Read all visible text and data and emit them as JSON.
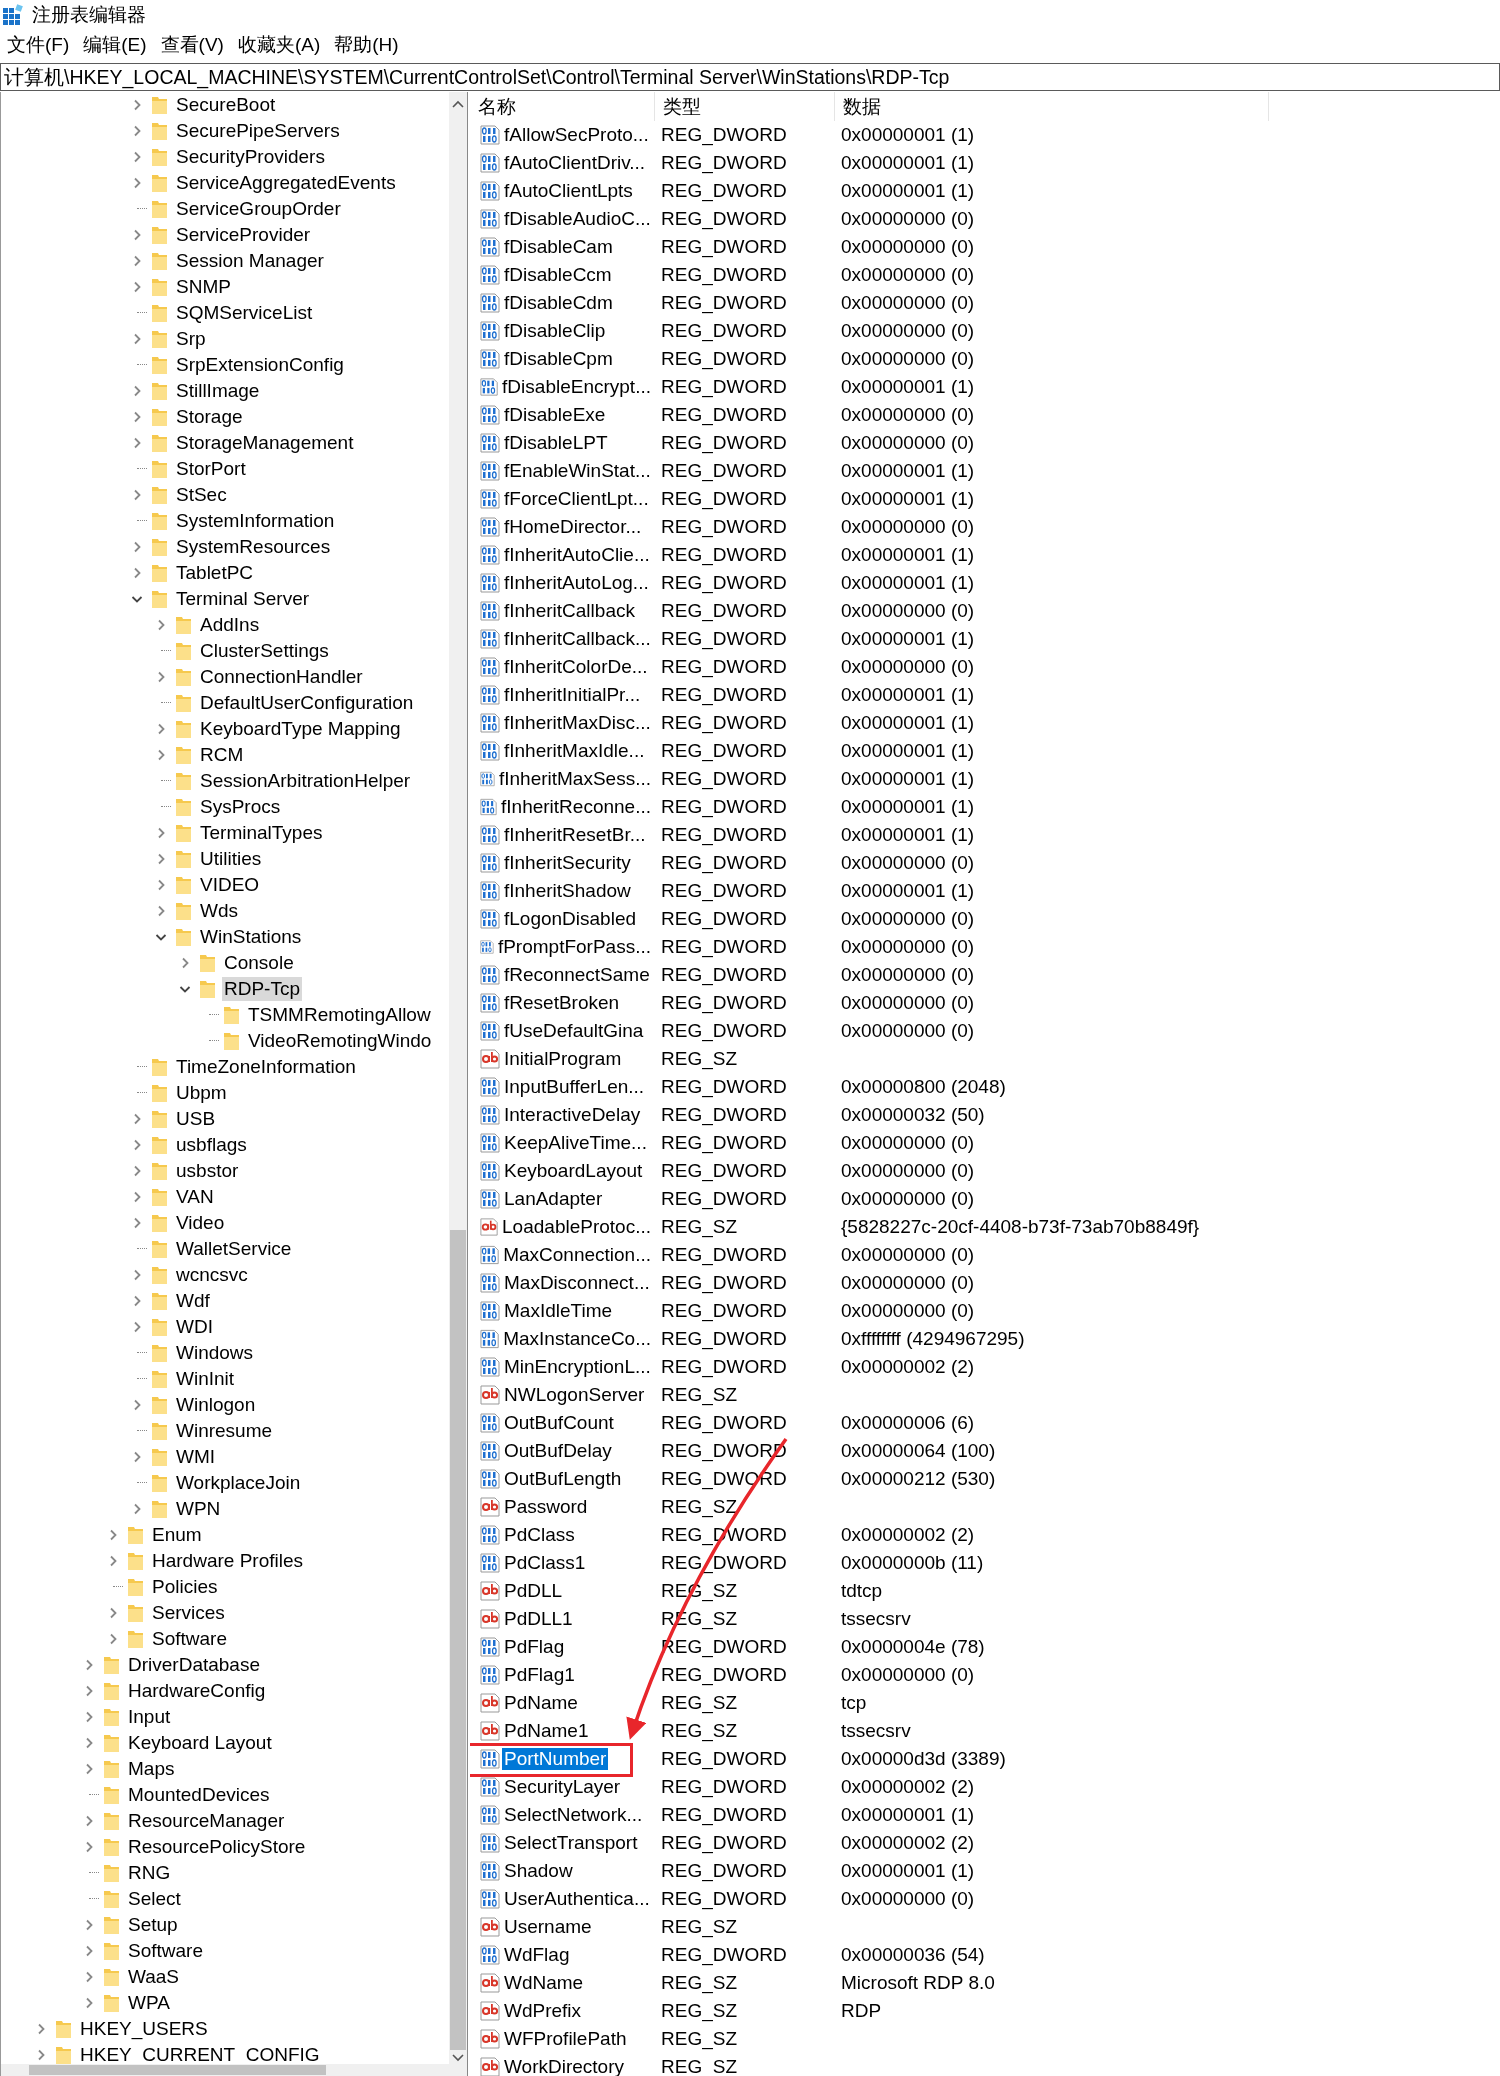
{
  "window": {
    "title": "注册表编辑器"
  },
  "menu": [
    "文件(F)",
    "编辑(E)",
    "查看(V)",
    "收藏夹(A)",
    "帮助(H)"
  ],
  "address": "计算机\\HKEY_LOCAL_MACHINE\\SYSTEM\\CurrentControlSet\\Control\\Terminal Server\\WinStations\\RDP-Tcp",
  "tree": [
    {
      "children": [
        {
          "children": [
            {
              "children": [
                {
                  "children": [
                    {
                      "children": [
                        {
                          "label": "SecureBoot",
                          "expandable": true,
                          "expanded": false,
                          "selected": false
                        },
                        {
                          "label": "SecurePipeServers",
                          "expandable": true,
                          "expanded": false,
                          "selected": false
                        },
                        {
                          "label": "SecurityProviders",
                          "expandable": true,
                          "expanded": false,
                          "selected": false
                        },
                        {
                          "label": "ServiceAggregatedEvents",
                          "expandable": true,
                          "expanded": false,
                          "selected": false
                        },
                        {
                          "label": "ServiceGroupOrder",
                          "expandable": false,
                          "selected": false
                        },
                        {
                          "label": "ServiceProvider",
                          "expandable": true,
                          "expanded": false,
                          "selected": false
                        },
                        {
                          "label": "Session Manager",
                          "expandable": true,
                          "expanded": false,
                          "selected": false
                        },
                        {
                          "label": "SNMP",
                          "expandable": true,
                          "expanded": false,
                          "selected": false
                        },
                        {
                          "label": "SQMServiceList",
                          "expandable": false,
                          "selected": false
                        },
                        {
                          "label": "Srp",
                          "expandable": true,
                          "expanded": false,
                          "selected": false
                        },
                        {
                          "label": "SrpExtensionConfig",
                          "expandable": false,
                          "selected": false
                        },
                        {
                          "label": "StillImage",
                          "expandable": true,
                          "expanded": false,
                          "selected": false
                        },
                        {
                          "label": "Storage",
                          "expandable": true,
                          "expanded": false,
                          "selected": false
                        },
                        {
                          "label": "StorageManagement",
                          "expandable": true,
                          "expanded": false,
                          "selected": false
                        },
                        {
                          "label": "StorPort",
                          "expandable": false,
                          "selected": false
                        },
                        {
                          "label": "StSec",
                          "expandable": true,
                          "expanded": false,
                          "selected": false
                        },
                        {
                          "label": "SystemInformation",
                          "expandable": false,
                          "selected": false
                        },
                        {
                          "label": "SystemResources",
                          "expandable": true,
                          "expanded": false,
                          "selected": false
                        },
                        {
                          "label": "TabletPC",
                          "expandable": true,
                          "expanded": false,
                          "selected": false
                        },
                        {
                          "label": "Terminal Server",
                          "expandable": true,
                          "expanded": true,
                          "selected": false,
                          "children": [
                            {
                              "label": "AddIns",
                              "expandable": true,
                              "expanded": false,
                              "selected": false
                            },
                            {
                              "label": "ClusterSettings",
                              "expandable": false,
                              "selected": false
                            },
                            {
                              "label": "ConnectionHandler",
                              "expandable": true,
                              "expanded": false,
                              "selected": false
                            },
                            {
                              "label": "DefaultUserConfiguration",
                              "expandable": false,
                              "selected": false
                            },
                            {
                              "label": "KeyboardType Mapping",
                              "expandable": true,
                              "expanded": false,
                              "selected": false
                            },
                            {
                              "label": "RCM",
                              "expandable": true,
                              "expanded": false,
                              "selected": false
                            },
                            {
                              "label": "SessionArbitrationHelper",
                              "expandable": false,
                              "selected": false
                            },
                            {
                              "label": "SysProcs",
                              "expandable": false,
                              "selected": false
                            },
                            {
                              "label": "TerminalTypes",
                              "expandable": true,
                              "expanded": false,
                              "selected": false
                            },
                            {
                              "label": "Utilities",
                              "expandable": true,
                              "expanded": false,
                              "selected": false
                            },
                            {
                              "label": "VIDEO",
                              "expandable": true,
                              "expanded": false,
                              "selected": false
                            },
                            {
                              "label": "Wds",
                              "expandable": true,
                              "expanded": false,
                              "selected": false
                            },
                            {
                              "label": "WinStations",
                              "expandable": true,
                              "expanded": true,
                              "selected": false,
                              "children": [
                                {
                                  "label": "Console",
                                  "expandable": true,
                                  "expanded": false,
                                  "selected": false
                                },
                                {
                                  "label": "RDP-Tcp",
                                  "expandable": true,
                                  "expanded": true,
                                  "selected": true,
                                  "children": [
                                    {
                                      "label": "TSMMRemotingAllow",
                                      "expandable": false,
                                      "selected": false
                                    },
                                    {
                                      "label": "VideoRemotingWindo",
                                      "expandable": false,
                                      "selected": false
                                    }
                                  ]
                                }
                              ]
                            }
                          ]
                        },
                        {
                          "label": "TimeZoneInformation",
                          "expandable": false,
                          "selected": false
                        },
                        {
                          "label": "Ubpm",
                          "expandable": false,
                          "selected": false
                        },
                        {
                          "label": "USB",
                          "expandable": true,
                          "expanded": false,
                          "selected": false
                        },
                        {
                          "label": "usbflags",
                          "expandable": true,
                          "expanded": false,
                          "selected": false
                        },
                        {
                          "label": "usbstor",
                          "expandable": true,
                          "expanded": false,
                          "selected": false
                        },
                        {
                          "label": "VAN",
                          "expandable": true,
                          "expanded": false,
                          "selected": false
                        },
                        {
                          "label": "Video",
                          "expandable": true,
                          "expanded": false,
                          "selected": false
                        },
                        {
                          "label": "WalletService",
                          "expandable": false,
                          "selected": false
                        },
                        {
                          "label": "wcncsvc",
                          "expandable": true,
                          "expanded": false,
                          "selected": false
                        },
                        {
                          "label": "Wdf",
                          "expandable": true,
                          "expanded": false,
                          "selected": false
                        },
                        {
                          "label": "WDI",
                          "expandable": true,
                          "expanded": false,
                          "selected": false
                        },
                        {
                          "label": "Windows",
                          "expandable": false,
                          "selected": false
                        },
                        {
                          "label": "WinInit",
                          "expandable": false,
                          "selected": false
                        },
                        {
                          "label": "Winlogon",
                          "expandable": true,
                          "expanded": false,
                          "selected": false
                        },
                        {
                          "label": "Winresume",
                          "expandable": false,
                          "selected": false
                        },
                        {
                          "label": "WMI",
                          "expandable": true,
                          "expanded": false,
                          "selected": false
                        },
                        {
                          "label": "WorkplaceJoin",
                          "expandable": false,
                          "selected": false
                        },
                        {
                          "label": "WPN",
                          "expandable": true,
                          "expanded": false,
                          "selected": false
                        }
                      ]
                    },
                    {
                      "label": "Enum",
                      "expandable": true,
                      "expanded": false,
                      "selected": false
                    },
                    {
                      "label": "Hardware Profiles",
                      "expandable": true,
                      "expanded": false,
                      "selected": false
                    },
                    {
                      "label": "Policies",
                      "expandable": false,
                      "selected": false
                    },
                    {
                      "label": "Services",
                      "expandable": true,
                      "expanded": false,
                      "selected": false
                    },
                    {
                      "label": "Software",
                      "expandable": true,
                      "expanded": false,
                      "selected": false
                    }
                  ]
                },
                {
                  "label": "DriverDatabase",
                  "expandable": true,
                  "expanded": false,
                  "selected": false
                },
                {
                  "label": "HardwareConfig",
                  "expandable": true,
                  "expanded": false,
                  "selected": false
                },
                {
                  "label": "Input",
                  "expandable": true,
                  "expanded": false,
                  "selected": false
                },
                {
                  "label": "Keyboard Layout",
                  "expandable": true,
                  "expanded": false,
                  "selected": false
                },
                {
                  "label": "Maps",
                  "expandable": true,
                  "expanded": false,
                  "selected": false
                },
                {
                  "label": "MountedDevices",
                  "expandable": false,
                  "selected": false
                },
                {
                  "label": "ResourceManager",
                  "expandable": true,
                  "expanded": false,
                  "selected": false
                },
                {
                  "label": "ResourcePolicyStore",
                  "expandable": true,
                  "expanded": false,
                  "selected": false
                },
                {
                  "label": "RNG",
                  "expandable": false,
                  "selected": false
                },
                {
                  "label": "Select",
                  "expandable": false,
                  "selected": false
                },
                {
                  "label": "Setup",
                  "expandable": true,
                  "expanded": false,
                  "selected": false
                },
                {
                  "label": "Software",
                  "expandable": true,
                  "expanded": false,
                  "selected": false
                },
                {
                  "label": "WaaS",
                  "expandable": true,
                  "expanded": false,
                  "selected": false
                },
                {
                  "label": "WPA",
                  "expandable": true,
                  "expanded": false,
                  "selected": false
                }
              ]
            }
          ]
        },
        {
          "label": "HKEY_USERS",
          "expandable": true,
          "expanded": false,
          "selected": false
        },
        {
          "label": "HKEY_CURRENT_CONFIG",
          "expandable": true,
          "expanded": false,
          "selected": false
        }
      ]
    }
  ],
  "columns": [
    "名称",
    "类型",
    "数据"
  ],
  "values": [
    {
      "name": "fAllowSecProto...",
      "kind": "dword",
      "type": "REG_DWORD",
      "data": "0x00000001 (1)",
      "selected": false
    },
    {
      "name": "fAutoClientDriv...",
      "kind": "dword",
      "type": "REG_DWORD",
      "data": "0x00000001 (1)",
      "selected": false
    },
    {
      "name": "fAutoClientLpts",
      "kind": "dword",
      "type": "REG_DWORD",
      "data": "0x00000001 (1)",
      "selected": false
    },
    {
      "name": "fDisableAudioC...",
      "kind": "dword",
      "type": "REG_DWORD",
      "data": "0x00000000 (0)",
      "selected": false
    },
    {
      "name": "fDisableCam",
      "kind": "dword",
      "type": "REG_DWORD",
      "data": "0x00000000 (0)",
      "selected": false
    },
    {
      "name": "fDisableCcm",
      "kind": "dword",
      "type": "REG_DWORD",
      "data": "0x00000000 (0)",
      "selected": false
    },
    {
      "name": "fDisableCdm",
      "kind": "dword",
      "type": "REG_DWORD",
      "data": "0x00000000 (0)",
      "selected": false
    },
    {
      "name": "fDisableClip",
      "kind": "dword",
      "type": "REG_DWORD",
      "data": "0x00000000 (0)",
      "selected": false
    },
    {
      "name": "fDisableCpm",
      "kind": "dword",
      "type": "REG_DWORD",
      "data": "0x00000000 (0)",
      "selected": false
    },
    {
      "name": "fDisableEncrypt...",
      "kind": "dword",
      "type": "REG_DWORD",
      "data": "0x00000001 (1)",
      "selected": false
    },
    {
      "name": "fDisableExe",
      "kind": "dword",
      "type": "REG_DWORD",
      "data": "0x00000000 (0)",
      "selected": false
    },
    {
      "name": "fDisableLPT",
      "kind": "dword",
      "type": "REG_DWORD",
      "data": "0x00000000 (0)",
      "selected": false
    },
    {
      "name": "fEnableWinStat...",
      "kind": "dword",
      "type": "REG_DWORD",
      "data": "0x00000001 (1)",
      "selected": false
    },
    {
      "name": "fForceClientLpt...",
      "kind": "dword",
      "type": "REG_DWORD",
      "data": "0x00000001 (1)",
      "selected": false
    },
    {
      "name": "fHomeDirector...",
      "kind": "dword",
      "type": "REG_DWORD",
      "data": "0x00000000 (0)",
      "selected": false
    },
    {
      "name": "fInheritAutoClie...",
      "kind": "dword",
      "type": "REG_DWORD",
      "data": "0x00000001 (1)",
      "selected": false
    },
    {
      "name": "fInheritAutoLog...",
      "kind": "dword",
      "type": "REG_DWORD",
      "data": "0x00000001 (1)",
      "selected": false
    },
    {
      "name": "fInheritCallback",
      "kind": "dword",
      "type": "REG_DWORD",
      "data": "0x00000000 (0)",
      "selected": false
    },
    {
      "name": "fInheritCallback...",
      "kind": "dword",
      "type": "REG_DWORD",
      "data": "0x00000001 (1)",
      "selected": false
    },
    {
      "name": "fInheritColorDe...",
      "kind": "dword",
      "type": "REG_DWORD",
      "data": "0x00000000 (0)",
      "selected": false
    },
    {
      "name": "fInheritInitialPr...",
      "kind": "dword",
      "type": "REG_DWORD",
      "data": "0x00000001 (1)",
      "selected": false
    },
    {
      "name": "fInheritMaxDisc...",
      "kind": "dword",
      "type": "REG_DWORD",
      "data": "0x00000001 (1)",
      "selected": false
    },
    {
      "name": "fInheritMaxIdle...",
      "kind": "dword",
      "type": "REG_DWORD",
      "data": "0x00000001 (1)",
      "selected": false
    },
    {
      "name": "fInheritMaxSess...",
      "kind": "dword",
      "type": "REG_DWORD",
      "data": "0x00000001 (1)",
      "selected": false
    },
    {
      "name": "fInheritReconne...",
      "kind": "dword",
      "type": "REG_DWORD",
      "data": "0x00000001 (1)",
      "selected": false
    },
    {
      "name": "fInheritResetBr...",
      "kind": "dword",
      "type": "REG_DWORD",
      "data": "0x00000001 (1)",
      "selected": false
    },
    {
      "name": "fInheritSecurity",
      "kind": "dword",
      "type": "REG_DWORD",
      "data": "0x00000000 (0)",
      "selected": false
    },
    {
      "name": "fInheritShadow",
      "kind": "dword",
      "type": "REG_DWORD",
      "data": "0x00000001 (1)",
      "selected": false
    },
    {
      "name": "fLogonDisabled",
      "kind": "dword",
      "type": "REG_DWORD",
      "data": "0x00000000 (0)",
      "selected": false
    },
    {
      "name": "fPromptForPass...",
      "kind": "dword",
      "type": "REG_DWORD",
      "data": "0x00000000 (0)",
      "selected": false
    },
    {
      "name": "fReconnectSame",
      "kind": "dword",
      "type": "REG_DWORD",
      "data": "0x00000000 (0)",
      "selected": false
    },
    {
      "name": "fResetBroken",
      "kind": "dword",
      "type": "REG_DWORD",
      "data": "0x00000000 (0)",
      "selected": false
    },
    {
      "name": "fUseDefaultGina",
      "kind": "dword",
      "type": "REG_DWORD",
      "data": "0x00000000 (0)",
      "selected": false
    },
    {
      "name": "InitialProgram",
      "kind": "sz",
      "type": "REG_SZ",
      "selected": false
    },
    {
      "name": "InputBufferLen...",
      "kind": "dword",
      "type": "REG_DWORD",
      "data": "0x00000800 (2048)",
      "selected": false
    },
    {
      "name": "InteractiveDelay",
      "kind": "dword",
      "type": "REG_DWORD",
      "data": "0x00000032 (50)",
      "selected": false
    },
    {
      "name": "KeepAliveTime...",
      "kind": "dword",
      "type": "REG_DWORD",
      "data": "0x00000000 (0)",
      "selected": false
    },
    {
      "name": "KeyboardLayout",
      "kind": "dword",
      "type": "REG_DWORD",
      "data": "0x00000000 (0)",
      "selected": false
    },
    {
      "name": "LanAdapter",
      "kind": "dword",
      "type": "REG_DWORD",
      "data": "0x00000000 (0)",
      "selected": false
    },
    {
      "name": "LoadableProtoc...",
      "kind": "sz",
      "type": "REG_SZ",
      "data": "{5828227c-20cf-4408-b73f-73ab70b8849f}",
      "selected": false
    },
    {
      "name": "MaxConnection...",
      "kind": "dword",
      "type": "REG_DWORD",
      "data": "0x00000000 (0)",
      "selected": false
    },
    {
      "name": "MaxDisconnect...",
      "kind": "dword",
      "type": "REG_DWORD",
      "data": "0x00000000 (0)",
      "selected": false
    },
    {
      "name": "MaxIdleTime",
      "kind": "dword",
      "type": "REG_DWORD",
      "data": "0x00000000 (0)",
      "selected": false
    },
    {
      "name": "MaxInstanceCo...",
      "kind": "dword",
      "type": "REG_DWORD",
      "data": "0xffffffff (4294967295)",
      "selected": false
    },
    {
      "name": "MinEncryptionL...",
      "kind": "dword",
      "type": "REG_DWORD",
      "data": "0x00000002 (2)",
      "selected": false
    },
    {
      "name": "NWLogonServer",
      "kind": "sz",
      "type": "REG_SZ",
      "selected": false
    },
    {
      "name": "OutBufCount",
      "kind": "dword",
      "type": "REG_DWORD",
      "data": "0x00000006 (6)",
      "selected": false
    },
    {
      "name": "OutBufDelay",
      "kind": "dword",
      "type": "REG_DWORD",
      "data": "0x00000064 (100)",
      "selected": false
    },
    {
      "name": "OutBufLength",
      "kind": "dword",
      "type": "REG_DWORD",
      "data": "0x00000212 (530)",
      "selected": false
    },
    {
      "name": "Password",
      "kind": "sz",
      "type": "REG_SZ",
      "selected": false
    },
    {
      "name": "PdClass",
      "kind": "dword",
      "type": "REG_DWORD",
      "data": "0x00000002 (2)",
      "selected": false
    },
    {
      "name": "PdClass1",
      "kind": "dword",
      "type": "REG_DWORD",
      "data": "0x0000000b (11)",
      "selected": false
    },
    {
      "name": "PdDLL",
      "kind": "sz",
      "type": "REG_SZ",
      "data": "tdtcp",
      "selected": false
    },
    {
      "name": "PdDLL1",
      "kind": "sz",
      "type": "REG_SZ",
      "data": "tssecsrv",
      "selected": false
    },
    {
      "name": "PdFlag",
      "kind": "dword",
      "type": "REG_DWORD",
      "data": "0x0000004e (78)",
      "selected": false
    },
    {
      "name": "PdFlag1",
      "kind": "dword",
      "type": "REG_DWORD",
      "data": "0x00000000 (0)",
      "selected": false
    },
    {
      "name": "PdName",
      "kind": "sz",
      "type": "REG_SZ",
      "data": "tcp",
      "selected": false
    },
    {
      "name": "PdName1",
      "kind": "sz",
      "type": "REG_SZ",
      "data": "tssecsrv",
      "selected": false
    },
    {
      "name": "PortNumber",
      "kind": "dword",
      "type": "REG_DWORD",
      "data": "0x00000d3d (3389)",
      "selected": true
    },
    {
      "name": "SecurityLayer",
      "kind": "dword",
      "type": "REG_DWORD",
      "data": "0x00000002 (2)",
      "selected": false
    },
    {
      "name": "SelectNetwork...",
      "kind": "dword",
      "type": "REG_DWORD",
      "data": "0x00000001 (1)",
      "selected": false
    },
    {
      "name": "SelectTransport",
      "kind": "dword",
      "type": "REG_DWORD",
      "data": "0x00000002 (2)",
      "selected": false
    },
    {
      "name": "Shadow",
      "kind": "dword",
      "type": "REG_DWORD",
      "data": "0x00000001 (1)",
      "selected": false
    },
    {
      "name": "UserAuthentica...",
      "kind": "dword",
      "type": "REG_DWORD",
      "data": "0x00000000 (0)",
      "selected": false
    },
    {
      "name": "Username",
      "kind": "sz",
      "type": "REG_SZ",
      "selected": false
    },
    {
      "name": "WdFlag",
      "kind": "dword",
      "type": "REG_DWORD",
      "data": "0x00000036 (54)",
      "selected": false
    },
    {
      "name": "WdName",
      "kind": "sz",
      "type": "REG_SZ",
      "data": "Microsoft RDP 8.0",
      "selected": false
    },
    {
      "name": "WdPrefix",
      "kind": "sz",
      "type": "REG_SZ",
      "data": "RDP",
      "selected": false
    },
    {
      "name": "WFProfilePath",
      "kind": "sz",
      "type": "REG_SZ",
      "selected": false
    },
    {
      "name": "WorkDirectory",
      "kind": "sz",
      "type": "REG_SZ",
      "selected": false
    }
  ]
}
